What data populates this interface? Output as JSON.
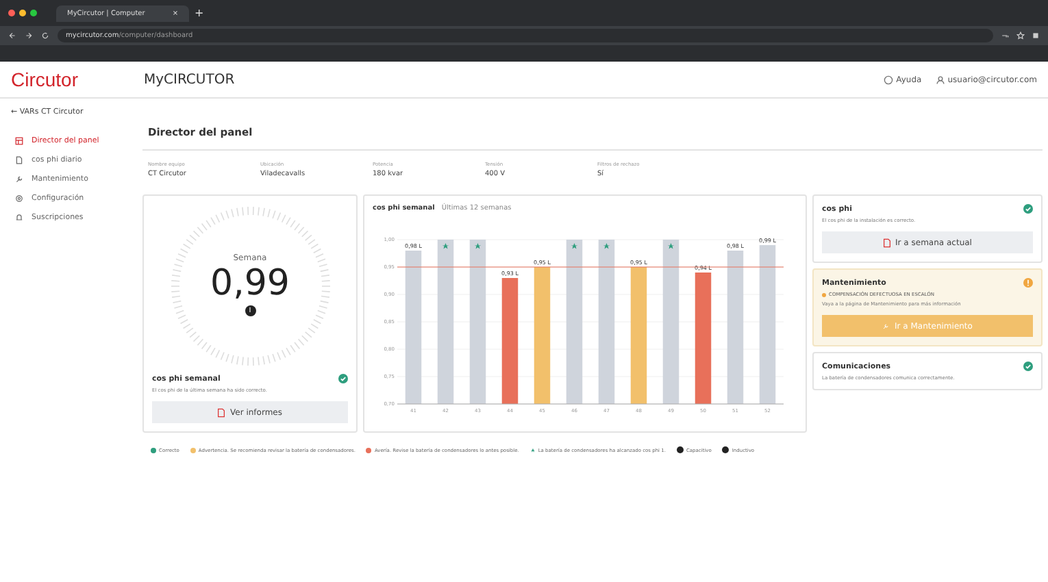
{
  "browser": {
    "tab_title": "MyCircutor | Computer",
    "tab_close": "×",
    "new_tab": "+",
    "url_host": "mycircutor.com",
    "url_path": "/computer/dashboard"
  },
  "header": {
    "logo": "Circutor",
    "app_name": "MyCIRCUTOR",
    "help": "Ayuda",
    "user": "usuario@circutor.com"
  },
  "sidebar": {
    "back_arrow": "←",
    "back": "VARs CT Circutor",
    "items": [
      {
        "label": "Director del panel",
        "kind": "dashboard",
        "selected": true
      },
      {
        "label": "cos phi diario",
        "kind": "file",
        "selected": false
      },
      {
        "label": "Mantenimiento",
        "kind": "wrench",
        "selected": false
      },
      {
        "label": "Configuración",
        "kind": "gear",
        "selected": false
      },
      {
        "label": "Suscripciones",
        "kind": "bell",
        "selected": false
      }
    ]
  },
  "page_title": "Director del panel",
  "info": [
    {
      "label": "Nombre equipo",
      "value": "CT Circutor"
    },
    {
      "label": "Ubicación",
      "value": "Viladecavalls"
    },
    {
      "label": "Potencia",
      "value": "180 kvar"
    },
    {
      "label": "Tensión",
      "value": "400 V"
    },
    {
      "label": "Filtros de rechazo",
      "value": "Sí"
    }
  ],
  "gauge": {
    "caption": "Semana",
    "value": "0,99",
    "badge": "I",
    "title": "cos phi semanal",
    "kind": "ok",
    "text": "El cos phi de la última semana ha sido correcto.",
    "button": "Ver informes"
  },
  "chart": {
    "title": "cos phi semanal",
    "subtitle": "Últimas 12 semanas",
    "chart_data": {
      "type": "bar",
      "categories": [
        "41",
        "42",
        "43",
        "44",
        "45",
        "46",
        "47",
        "48",
        "49",
        "50",
        "51",
        "52"
      ],
      "series": [
        {
          "color": "#cfd4dc",
          "values": [
            0.98,
            1.0,
            1.0,
            null,
            null,
            1.0,
            1.0,
            null,
            1.0,
            null,
            0.98,
            0.99
          ]
        },
        {
          "color": "#f2c06b",
          "values": [
            null,
            null,
            null,
            null,
            0.95,
            null,
            null,
            0.95,
            null,
            null,
            null,
            null
          ]
        },
        {
          "color": "#e8705a",
          "values": [
            null,
            null,
            null,
            0.93,
            null,
            null,
            null,
            null,
            null,
            0.94,
            null,
            null
          ]
        }
      ],
      "grid": true,
      "ylim": [
        0.7,
        1.0
      ],
      "yticks": [
        {
          "value": 0.7,
          "label": "0,70"
        },
        {
          "value": 0.75,
          "label": "0,75"
        },
        {
          "value": 0.8,
          "label": "0,80"
        },
        {
          "value": 0.85,
          "label": "0,85"
        },
        {
          "value": 0.9,
          "label": "0,90"
        },
        {
          "value": 0.95,
          "label": "0,95"
        },
        {
          "value": 1.0,
          "label": "1,00"
        }
      ],
      "ref_lines": [
        {
          "axis": "y",
          "value": 0.95,
          "color": "#e8705a"
        }
      ]
    },
    "bars": [
      {
        "kind": "label",
        "text": "0,98 L"
      },
      {
        "kind": "star"
      },
      {
        "kind": "star"
      },
      {
        "kind": "label",
        "text": "0,93 L"
      },
      {
        "kind": "label",
        "text": "0,95 L"
      },
      {
        "kind": "star"
      },
      {
        "kind": "star"
      },
      {
        "kind": "label",
        "text": "0,95 L"
      },
      {
        "kind": "star"
      },
      {
        "kind": "label",
        "text": "0,94 L"
      },
      {
        "kind": "label",
        "text": "0,98 L"
      },
      {
        "kind": "label",
        "text": "0,99 L"
      }
    ]
  },
  "status_cards": [
    {
      "title": "cos phi",
      "kind": "ok",
      "text": "El cos phi de la instalación es correcto.",
      "button": "Ir a semana actual"
    },
    {
      "title": "Mantenimiento",
      "kind": "warning",
      "alert": "COMPENSACIÓN DEFECTUOSA EN ESCALÓN",
      "text": "Vaya a la página de Mantenimiento para más información",
      "button": "Ir a Mantenimiento"
    },
    {
      "title": "Comunicaciones",
      "kind": "ok",
      "text": "La batería de condensadores comunica correctamente."
    }
  ],
  "legend": [
    {
      "kind": "dot",
      "color": "#2e9e7e",
      "text": "Correcto"
    },
    {
      "kind": "dot",
      "color": "#f2c06b",
      "text": "Advertencia. Se recomienda revisar la batería de condensadores."
    },
    {
      "kind": "dot",
      "color": "#e8705a",
      "text": "Avería. Revise la batería de condensadores lo antes posible."
    },
    {
      "kind": "star",
      "color": "#2e9e7e",
      "text": "La batería de condensadores ha alcanzado cos phi 1."
    },
    {
      "kind": "badge",
      "color": "#222222",
      "text": "Capacitivo"
    },
    {
      "kind": "badge",
      "color": "#222222",
      "text": "Inductivo"
    }
  ]
}
